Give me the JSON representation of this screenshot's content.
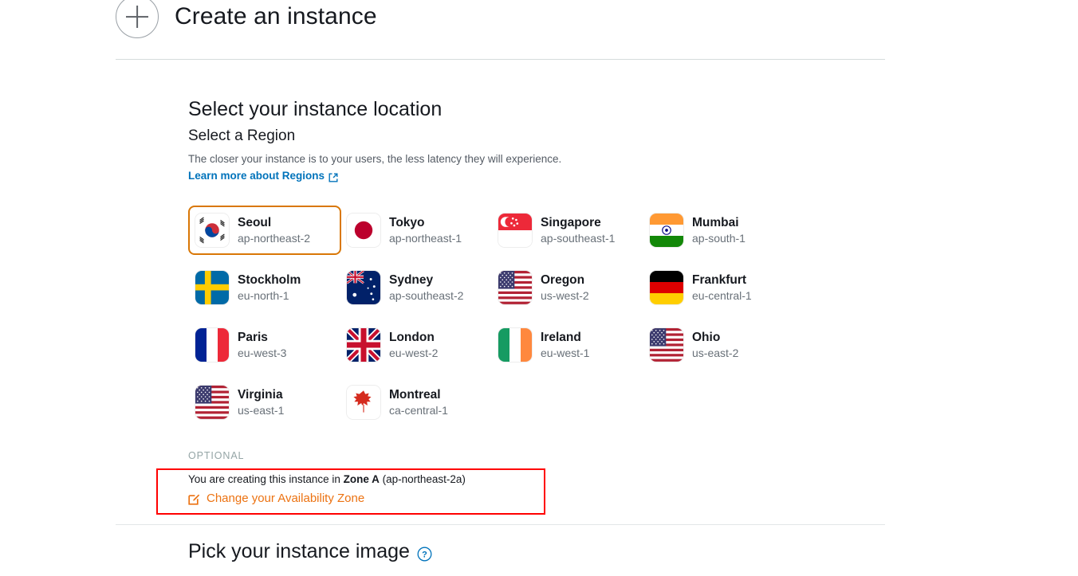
{
  "header": {
    "title": "Create an instance",
    "add_icon": "plus-circle-icon"
  },
  "location_section": {
    "title": "Select your instance location",
    "subtitle": "Select a Region",
    "description": "The closer your instance is to your users, the less latency they will experience.",
    "learn_more_label": "Learn more about Regions",
    "learn_more_icon": "external-link-icon",
    "selected_region_code": "ap-northeast-2",
    "accent_selected_color": "#d97706",
    "link_color": "#0073bb"
  },
  "regions": [
    {
      "name": "Seoul",
      "code": "ap-northeast-2",
      "flag": "kr",
      "selected": true
    },
    {
      "name": "Tokyo",
      "code": "ap-northeast-1",
      "flag": "jp",
      "selected": false
    },
    {
      "name": "Singapore",
      "code": "ap-southeast-1",
      "flag": "sg",
      "selected": false
    },
    {
      "name": "Mumbai",
      "code": "ap-south-1",
      "flag": "in",
      "selected": false
    },
    {
      "name": "Stockholm",
      "code": "eu-north-1",
      "flag": "se",
      "selected": false
    },
    {
      "name": "Sydney",
      "code": "ap-southeast-2",
      "flag": "au",
      "selected": false
    },
    {
      "name": "Oregon",
      "code": "us-west-2",
      "flag": "us",
      "selected": false
    },
    {
      "name": "Frankfurt",
      "code": "eu-central-1",
      "flag": "de",
      "selected": false
    },
    {
      "name": "Paris",
      "code": "eu-west-3",
      "flag": "fr",
      "selected": false
    },
    {
      "name": "London",
      "code": "eu-west-2",
      "flag": "gb",
      "selected": false
    },
    {
      "name": "Ireland",
      "code": "eu-west-1",
      "flag": "ie",
      "selected": false
    },
    {
      "name": "Ohio",
      "code": "us-east-2",
      "flag": "us",
      "selected": false
    },
    {
      "name": "Virginia",
      "code": "us-east-1",
      "flag": "us",
      "selected": false
    },
    {
      "name": "Montreal",
      "code": "ca-central-1",
      "flag": "ca",
      "selected": false
    }
  ],
  "availability_zone": {
    "optional_label": "OPTIONAL",
    "text_prefix": "You are creating this instance in ",
    "zone_name": "Zone A",
    "zone_code": " (ap-northeast-2a)",
    "change_label": "Change your Availability Zone",
    "change_icon": "edit-pencil-icon",
    "change_color": "#ec7211",
    "highlight_color": "#ff0000"
  },
  "image_section": {
    "title": "Pick your instance image",
    "help_icon": "question-mark-circle-icon"
  }
}
